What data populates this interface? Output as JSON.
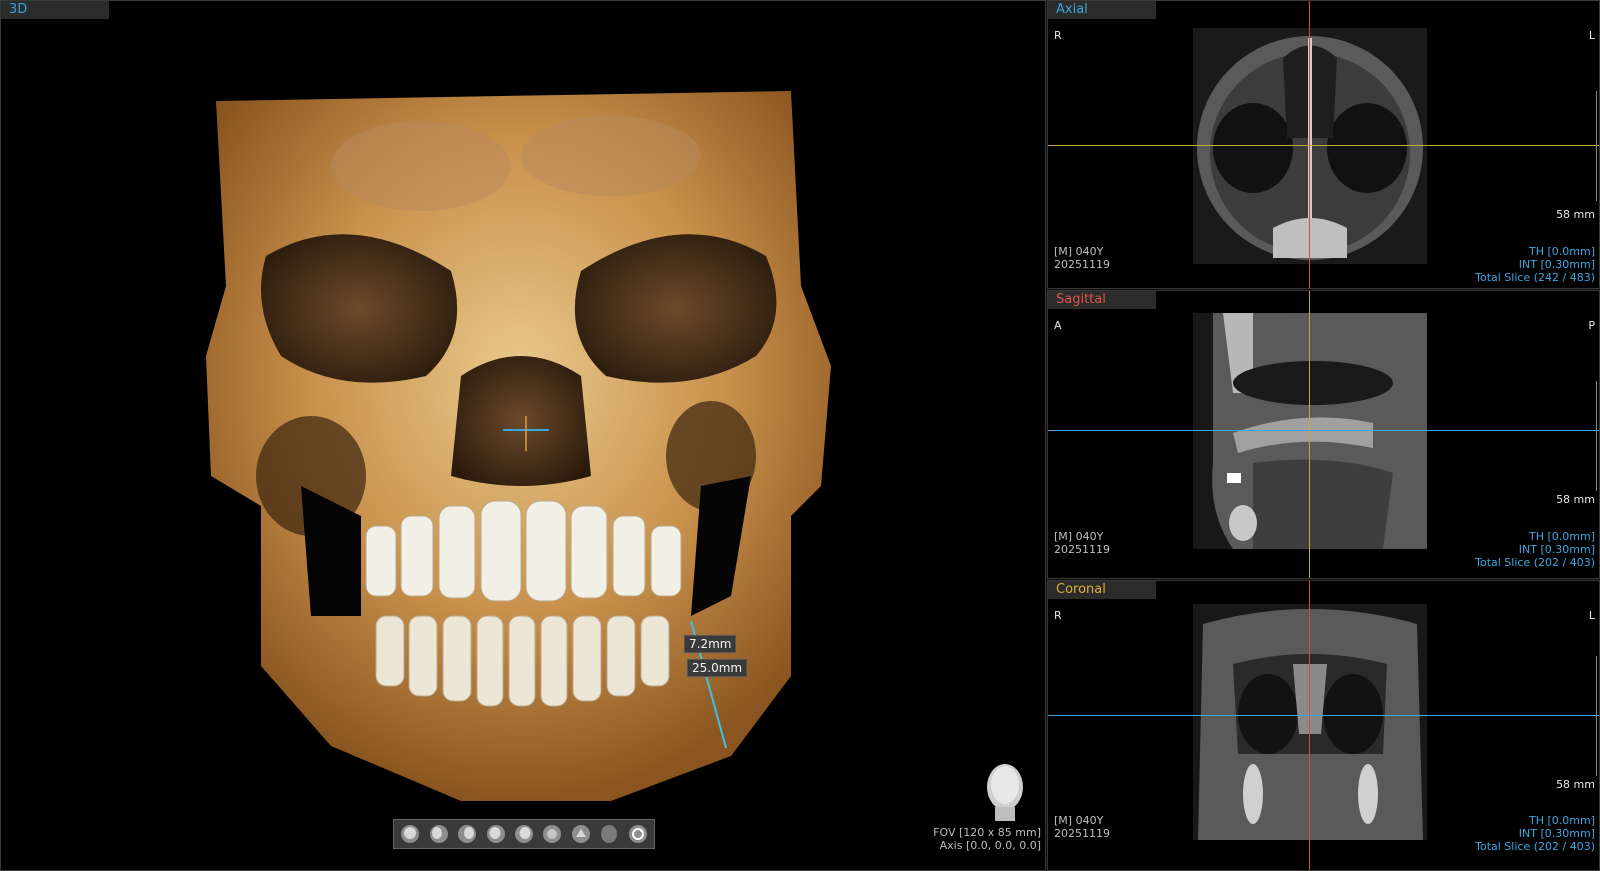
{
  "views": {
    "v3d": {
      "title": "3D",
      "title_color": "#2ea3d8"
    },
    "axial": {
      "title": "Axial",
      "title_color": "#3ea6e0",
      "left": "R",
      "right": "L"
    },
    "sagittal": {
      "title": "Sagittal",
      "title_color": "#e0554a",
      "left": "A",
      "right": "P"
    },
    "coronal": {
      "title": "Coronal",
      "title_color": "#d8b13a",
      "left": "R",
      "right": "L"
    }
  },
  "measurements": {
    "m1": "7.2mm",
    "m2": "25.0mm"
  },
  "fov": "FOV [120 x 85 mm]",
  "axis": "Axis [0.0, 0.0, 0.0]",
  "scale": "58 mm",
  "patient": {
    "sex_age": "[M] 040Y",
    "date": "20251119"
  },
  "slice": {
    "th": "TH [0.0mm]",
    "int": "INT [0.30mm]",
    "axial_total": "Total Slice (242 / 483)",
    "sagittal_total": "Total Slice (202 / 403)",
    "coronal_total": "Total Slice (202 / 403)"
  },
  "toolbar": [
    "face-front-icon",
    "face-left-icon",
    "face-right-icon",
    "face-left45-icon",
    "face-right45-icon",
    "head-top-icon",
    "head-bottom-icon",
    "head-back-icon",
    "rotate-icon"
  ]
}
